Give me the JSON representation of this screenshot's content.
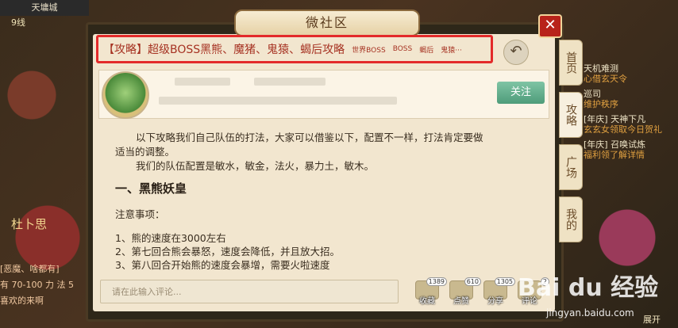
{
  "game_hud": {
    "location": "天墉城",
    "gold": "9线",
    "npc_name": "杜卜思",
    "left_chat": [
      "[恶魔、啥都有]",
      "有 70-100 力 法 5",
      "喜欢的来啊"
    ],
    "right_items": [
      {
        "title": "天机难测",
        "sub": "心借玄天令"
      },
      {
        "title": "巡司",
        "sub": "维护秩序"
      },
      {
        "title": "[年庆] 天神下凡",
        "sub": "玄玄女领取今日贺礼"
      },
      {
        "title": "[年庆] 召唤试炼",
        "sub": "福利领了解详情"
      }
    ],
    "expand_label": "展开"
  },
  "dialog": {
    "title": "微社区",
    "close_label": "✕",
    "back_icon": "back-arrow-icon"
  },
  "post": {
    "headline": "【攻略】超级BOSS黑熊、魔猪、鬼猿、蝎后攻略",
    "tags": [
      "世界BOSS",
      "BOSS",
      "蝎后",
      "鬼猿···"
    ],
    "follow_label": "关注",
    "paragraphs": [
      "以下攻略我们自己队伍的打法，大家可以借鉴以下，配置不一样，打法肯定要做适当的调整。",
      "我们的队伍配置是敏水，敏金，法火，暴力土，敏木。"
    ],
    "section_title": "一、黑熊妖皇",
    "notes_title": "注意事项：",
    "notes": [
      "1、熊的速度在3000左右",
      "2、第七回合熊会暴怒，速度会降低，并且放大招。",
      "3、第八回合开始熊的速度会暴增，需要火啦速度"
    ]
  },
  "comment": {
    "placeholder": "请在此输入评论..."
  },
  "actions": [
    {
      "label": "收藏",
      "count": "1389",
      "icon": "star-icon"
    },
    {
      "label": "点赞",
      "count": "610",
      "icon": "thumb-icon"
    },
    {
      "label": "分享",
      "count": "1305",
      "icon": "share-icon"
    },
    {
      "label": "评论",
      "count": "2",
      "icon": "comment-icon"
    }
  ],
  "side_tabs": [
    {
      "label": "首页"
    },
    {
      "label": "攻略"
    },
    {
      "label": "广场"
    },
    {
      "label": "我的"
    }
  ],
  "watermark": {
    "brand": "Bai du 经验",
    "url": "jingyan.baidu.com"
  },
  "colors": {
    "headline_border": "#e32a2a",
    "headline_text": "#a63222",
    "follow_button": "#5fae8a",
    "close_button": "#b8231a",
    "panel_bg": "#f2e6cf"
  }
}
